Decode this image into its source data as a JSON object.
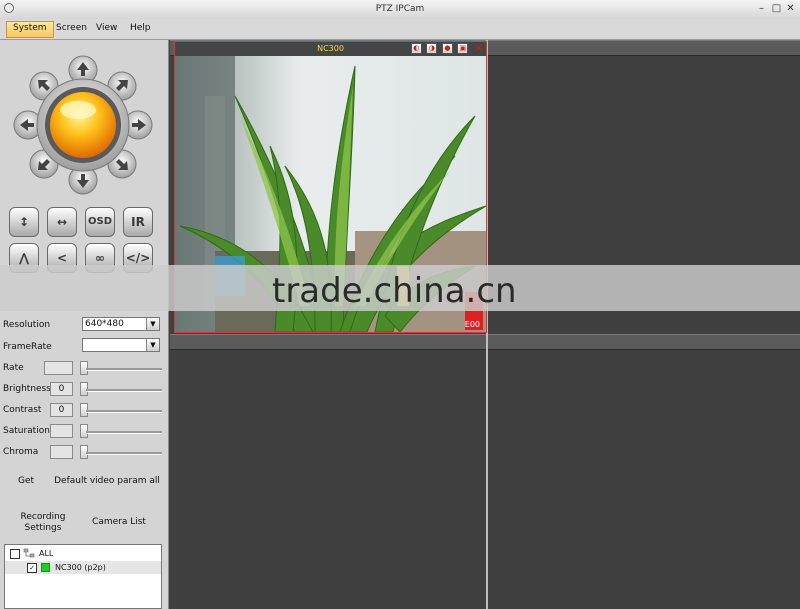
{
  "window": {
    "title": "PTZ IPCam",
    "minimize": "–",
    "maximize": "□",
    "close": "✕"
  },
  "menu": [
    {
      "label": "System"
    },
    {
      "label": "Screen"
    },
    {
      "label": "View"
    },
    {
      "label": "Help"
    }
  ],
  "toolbar": {
    "osd": "OSD",
    "ir": "IR",
    "vflip": "↕",
    "hflip": "↔",
    "icons": [
      "vertical-patrol-icon",
      "horizontal-patrol-icon",
      "up-icon",
      "back-icon",
      "loop-icon",
      "code-icon"
    ]
  },
  "params": {
    "resolution_label": "Resolution",
    "resolution_value": "640*480",
    "framerate_label": "FrameRate",
    "framerate_value": "",
    "rate_label": "Rate",
    "rate_value": "",
    "brightness_label": "Brightness",
    "brightness_value": "0",
    "contrast_label": "Contrast",
    "contrast_value": "0",
    "saturation_label": "Saturation",
    "saturation_value": "",
    "chroma_label": "Chroma",
    "chroma_value": ""
  },
  "actions": {
    "get": "Get",
    "default": "Default video param all",
    "recording_line1": "Recording",
    "recording_line2": "Settings",
    "camera_list": "Camera List"
  },
  "tree": {
    "all": "ALL",
    "camera": "NC300 (p2p)",
    "camera_status_color": "#22cc22"
  },
  "camera": {
    "name": "NC300",
    "corner_label": "E00",
    "title_color": "#f0d84a",
    "border_color": "#d43b3b"
  },
  "watermark": "trade.china.cn"
}
